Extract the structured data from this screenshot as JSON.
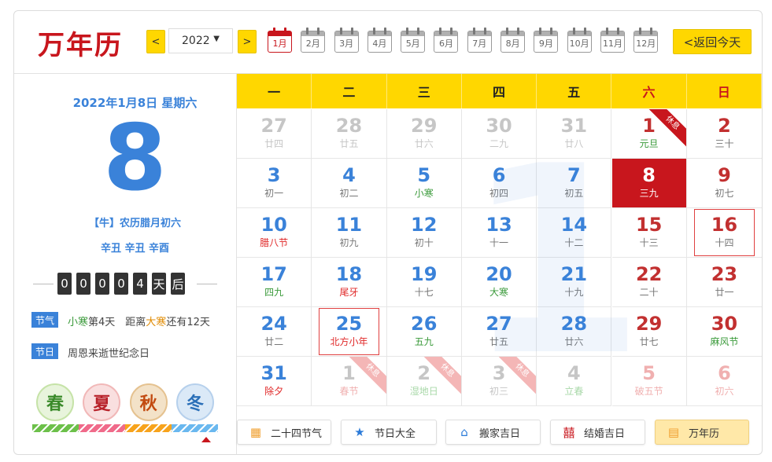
{
  "header": {
    "logo": "万年历",
    "prev_label": "<",
    "next_label": ">",
    "year_value": "2022",
    "months": [
      "1月",
      "2月",
      "3月",
      "4月",
      "5月",
      "6月",
      "7月",
      "8月",
      "9月",
      "10月",
      "11月",
      "12月"
    ],
    "active_month_index": 0,
    "today_label": "<返回今天"
  },
  "left": {
    "date_line": "2022年1月8日 星期六",
    "big_day": "8",
    "lunar": "【牛】农历腊月初六",
    "ganzhi": "辛丑 辛丑 辛酉",
    "counter_digits": [
      "0",
      "0",
      "0",
      "0",
      "4"
    ],
    "counter_units": [
      "天",
      "后"
    ],
    "solar_term_tag": "节气",
    "solar_term_parts": [
      "小寒",
      "第4天　距离",
      "大寒",
      "还有12天"
    ],
    "festival_tag": "节日",
    "festival_text": "周恩来逝世纪念日",
    "seasons": [
      "春",
      "夏",
      "秋",
      "冬"
    ],
    "season_bar_colors": [
      "#6cc04a",
      "#f06a8a",
      "#f7a31c",
      "#6ab8ef"
    ]
  },
  "weekdays": [
    "一",
    "二",
    "三",
    "四",
    "五",
    "六",
    "日"
  ],
  "calendar": {
    "watermark": "1",
    "rows": [
      [
        {
          "d": "27",
          "s": "廿四",
          "t": "dim"
        },
        {
          "d": "28",
          "s": "廿五",
          "t": "dim"
        },
        {
          "d": "29",
          "s": "廿六",
          "t": "dim"
        },
        {
          "d": "30",
          "s": "二九",
          "t": "dim"
        },
        {
          "d": "31",
          "s": "廿八",
          "t": "dim"
        },
        {
          "d": "1",
          "s": "元旦",
          "t": "red",
          "st": "term",
          "rib": "休息"
        },
        {
          "d": "2",
          "s": "三十",
          "t": "red"
        }
      ],
      [
        {
          "d": "3",
          "s": "初一",
          "t": "blue"
        },
        {
          "d": "4",
          "s": "初二",
          "t": "blue"
        },
        {
          "d": "5",
          "s": "小寒",
          "t": "blue",
          "st": "term"
        },
        {
          "d": "6",
          "s": "初四",
          "t": "blue"
        },
        {
          "d": "7",
          "s": "初五",
          "t": "blue"
        },
        {
          "d": "8",
          "s": "三九",
          "t": "today"
        },
        {
          "d": "9",
          "s": "初七",
          "t": "red"
        }
      ],
      [
        {
          "d": "10",
          "s": "腊八节",
          "t": "blue",
          "st": "fest"
        },
        {
          "d": "11",
          "s": "初九",
          "t": "blue"
        },
        {
          "d": "12",
          "s": "初十",
          "t": "blue"
        },
        {
          "d": "13",
          "s": "十一",
          "t": "blue"
        },
        {
          "d": "14",
          "s": "十二",
          "t": "blue"
        },
        {
          "d": "15",
          "s": "十三",
          "t": "red"
        },
        {
          "d": "16",
          "s": "十四",
          "t": "red",
          "box": true
        }
      ],
      [
        {
          "d": "17",
          "s": "四九",
          "t": "blue",
          "st": "term"
        },
        {
          "d": "18",
          "s": "尾牙",
          "t": "blue",
          "st": "fest"
        },
        {
          "d": "19",
          "s": "十七",
          "t": "blue"
        },
        {
          "d": "20",
          "s": "大寒",
          "t": "blue",
          "st": "term"
        },
        {
          "d": "21",
          "s": "十九",
          "t": "blue"
        },
        {
          "d": "22",
          "s": "二十",
          "t": "red"
        },
        {
          "d": "23",
          "s": "廿一",
          "t": "red"
        }
      ],
      [
        {
          "d": "24",
          "s": "廿二",
          "t": "blue"
        },
        {
          "d": "25",
          "s": "北方小年",
          "t": "blue",
          "st": "fest",
          "box": true
        },
        {
          "d": "26",
          "s": "五九",
          "t": "blue",
          "st": "term"
        },
        {
          "d": "27",
          "s": "廿五",
          "t": "blue"
        },
        {
          "d": "28",
          "s": "廿六",
          "t": "blue"
        },
        {
          "d": "29",
          "s": "廿七",
          "t": "red"
        },
        {
          "d": "30",
          "s": "麻风节",
          "t": "red",
          "st": "term"
        }
      ],
      [
        {
          "d": "31",
          "s": "除夕",
          "t": "blue",
          "st": "fest"
        },
        {
          "d": "1",
          "s": "春节",
          "t": "dim",
          "st": "fest",
          "rib": "休息",
          "ribl": true
        },
        {
          "d": "2",
          "s": "湿地日",
          "t": "dim",
          "st": "term",
          "rib": "休息",
          "ribl": true
        },
        {
          "d": "3",
          "s": "初三",
          "t": "dim",
          "rib": "休息",
          "ribl": true
        },
        {
          "d": "4",
          "s": "立春",
          "t": "dim",
          "st": "term"
        },
        {
          "d": "5",
          "s": "破五节",
          "t": "dimred",
          "st": "fest"
        },
        {
          "d": "6",
          "s": "初六",
          "t": "dimred"
        }
      ]
    ]
  },
  "bottom_buttons": [
    {
      "label": "二十四节气",
      "icon": "calendar-icon",
      "color": "#f0a030"
    },
    {
      "label": "节日大全",
      "icon": "star-icon",
      "color": "#2a7ad8"
    },
    {
      "label": "搬家吉日",
      "icon": "house-icon",
      "color": "#2a7ad8"
    },
    {
      "label": "结婚吉日",
      "icon": "double-happiness-icon",
      "color": "#c8161d"
    },
    {
      "label": "万年历",
      "icon": "almanac-icon",
      "color": "#f0a030",
      "active": true
    }
  ]
}
